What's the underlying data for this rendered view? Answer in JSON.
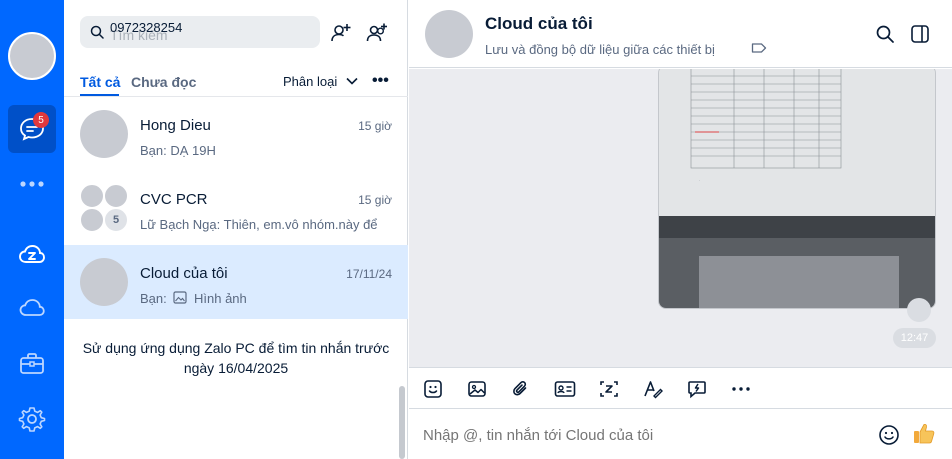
{
  "rail": {
    "unread_badge": "5",
    "items": [
      "messages",
      "more",
      "cloud-zalo",
      "cloud",
      "toolbox",
      "settings"
    ]
  },
  "search": {
    "placeholder": "Tìm kiếm",
    "value": "0972328254"
  },
  "tabs": {
    "all": "Tất cả",
    "unread": "Chưa đọc",
    "filter": "Phân loại",
    "more": "•••"
  },
  "conversations": [
    {
      "name": "Hong Dieu",
      "time": "15 giờ",
      "preview": "Bạn: DẠ 19H"
    },
    {
      "name": "CVC PCR",
      "time": "15 giờ",
      "preview": "Lữ Bạch Ngạ: Thiên, em.vô nhóm.này để",
      "member_count": "5"
    },
    {
      "name": "Cloud của tôi",
      "time": "17/11/24",
      "preview_prefix": "Bạn:",
      "preview": "Hình ảnh"
    }
  ],
  "footer_note": "Sử dụng ứng dụng Zalo PC để tìm tin nhắn trước ngày 16/04/2025",
  "chat": {
    "title": "Cloud của tôi",
    "subtitle": "Lưu và đồng bộ dữ liệu giữa các thiết bị",
    "message_time": "12:47",
    "input_placeholder": "Nhập @, tin nhắn tới Cloud của tôi"
  },
  "colors": {
    "rail": "#0068ff",
    "accent": "#005ae0",
    "selected": "#dbebff",
    "chat_bg": "#ebecf0"
  }
}
